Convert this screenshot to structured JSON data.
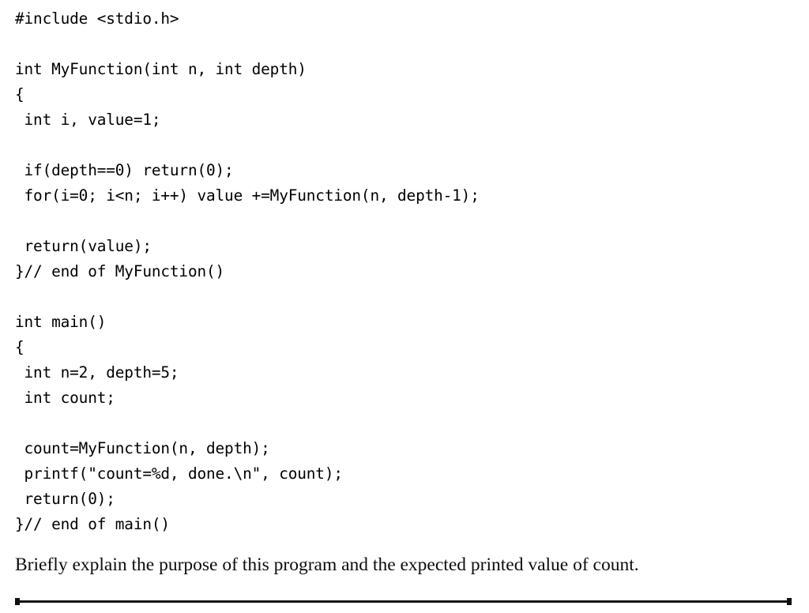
{
  "document": {
    "kind": "exam-question-page",
    "background_color": "#ffffff",
    "text_color": "#000000"
  },
  "code_listing": {
    "language": "c",
    "lines": [
      "#include <stdio.h>",
      "",
      "int MyFunction(int n, int depth)",
      "{",
      " int i, value=1;",
      "",
      " if(depth==0) return(0);",
      " for(i=0; i<n; i++) value +=MyFunction(n, depth-1);",
      "",
      " return(value);",
      "}// end of MyFunction()",
      "",
      "int main()",
      "{",
      " int n=2, depth=5;",
      " int count;",
      "",
      " count=MyFunction(n, depth);",
      " printf(\"count=%d, done.\\n\", count);",
      " return(0);",
      "}// end of main()"
    ]
  },
  "question": {
    "text": "Briefly explain the purpose of this program and the expected printed value of count."
  },
  "rule": {
    "color": "#111111"
  }
}
